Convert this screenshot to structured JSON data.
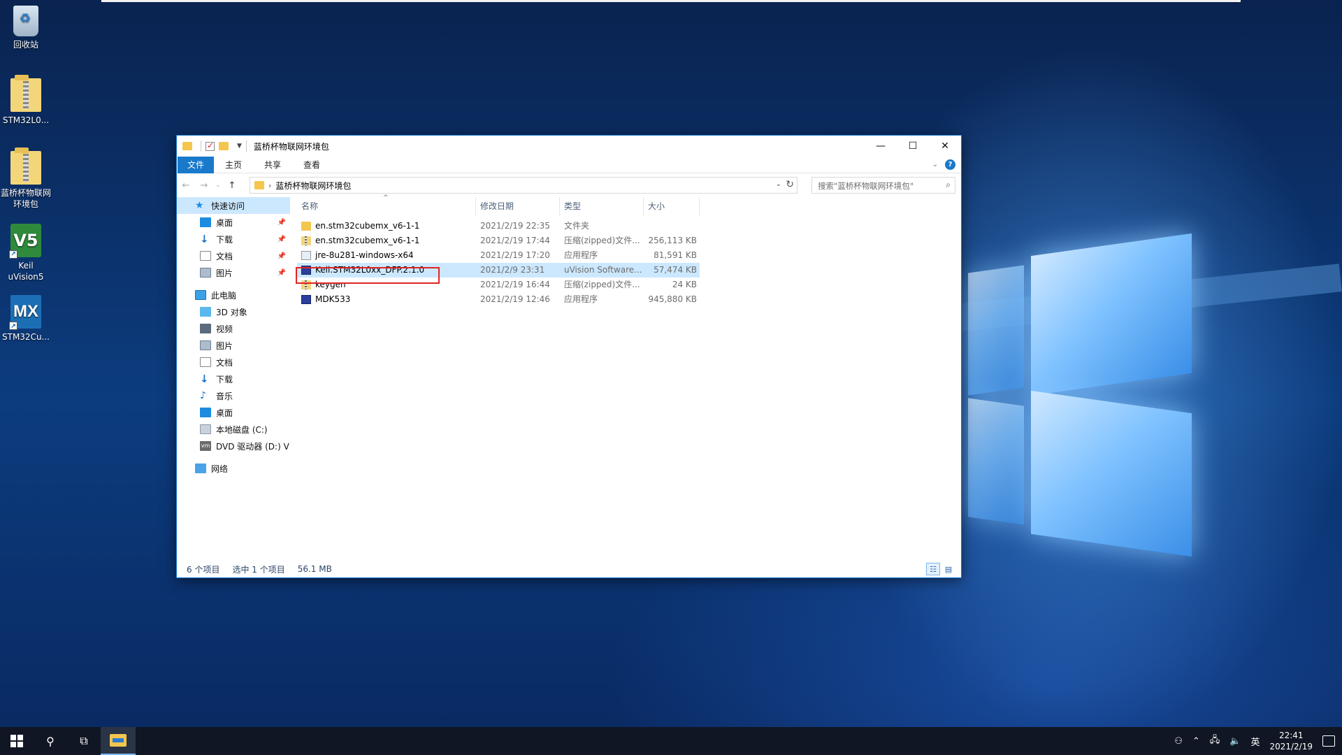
{
  "desktop": {
    "icons": [
      {
        "label": "回收站"
      },
      {
        "label": "STM32L0..."
      },
      {
        "label": "蓝桥杯物联网环境包"
      },
      {
        "label": "Keil uVision5",
        "glyph": "V5"
      },
      {
        "label": "STM32Cu...",
        "glyph": "MX"
      }
    ]
  },
  "window": {
    "title": "蓝桥杯物联网环境包",
    "controls": {
      "minimize": "—",
      "maximize": "☐",
      "close": "✕"
    },
    "ribbon_tabs": [
      "文件",
      "主页",
      "共享",
      "查看"
    ],
    "help": "?",
    "nav_buttons": {
      "back": "←",
      "forward": "→",
      "recent": "⌄",
      "up": "↑"
    },
    "address": {
      "chevron": "›",
      "path": "蓝桥杯物联网环境包",
      "dropdown": "⌄",
      "refresh": "↻"
    },
    "search": {
      "placeholder": "搜索\"蓝桥杯物联网环境包\"",
      "icon": "⌕"
    },
    "nav_pane": {
      "quick_access": "快速访问",
      "quick_items": [
        {
          "label": "桌面",
          "icon": "desktop-icon"
        },
        {
          "label": "下载",
          "icon": "download-icon"
        },
        {
          "label": "文档",
          "icon": "document-icon"
        },
        {
          "label": "图片",
          "icon": "picture-icon"
        }
      ],
      "this_pc": "此电脑",
      "pc_items": [
        {
          "label": "3D 对象",
          "icon": "3d-objects-icon"
        },
        {
          "label": "视频",
          "icon": "video-icon"
        },
        {
          "label": "图片",
          "icon": "picture-icon"
        },
        {
          "label": "文档",
          "icon": "document-icon"
        },
        {
          "label": "下载",
          "icon": "download-icon"
        },
        {
          "label": "音乐",
          "icon": "music-icon"
        },
        {
          "label": "桌面",
          "icon": "desktop-icon"
        },
        {
          "label": "本地磁盘 (C:)",
          "icon": "drive-icon"
        },
        {
          "label": "DVD 驱动器 (D:) V",
          "icon": "dvd-icon",
          "glyph": "vm"
        }
      ],
      "network": "网络"
    },
    "columns": {
      "name": "名称",
      "date": "修改日期",
      "type": "类型",
      "size": "大小"
    },
    "files": [
      {
        "name": "en.stm32cubemx_v6-1-1",
        "date": "2021/2/19 22:35",
        "type": "文件夹",
        "size": "",
        "icon": "folder-icon"
      },
      {
        "name": "en.stm32cubemx_v6-1-1",
        "date": "2021/2/19 17:44",
        "type": "压缩(zipped)文件...",
        "size": "256,113 KB",
        "icon": "zip-icon"
      },
      {
        "name": "jre-8u281-windows-x64",
        "date": "2021/2/19 17:20",
        "type": "应用程序",
        "size": "81,591 KB",
        "icon": "exe-icon"
      },
      {
        "name": "Keil.STM32L0xx_DFP.2.1.0",
        "date": "2021/2/9 23:31",
        "type": "uVision Software...",
        "size": "57,474 KB",
        "icon": "uvision-pack-icon",
        "selected": true
      },
      {
        "name": "keygen",
        "date": "2021/2/19 16:44",
        "type": "压缩(zipped)文件...",
        "size": "24 KB",
        "icon": "zip-icon"
      },
      {
        "name": "MDK533",
        "date": "2021/2/19 12:46",
        "type": "应用程序",
        "size": "945,880 KB",
        "icon": "uvision-setup-icon"
      }
    ],
    "status": {
      "count": "6 个项目",
      "selected": "选中 1 个项目",
      "size": "56.1 MB"
    }
  },
  "taskbar": {
    "clock_time": "22:41",
    "clock_date": "2021/2/19",
    "ime": "英"
  },
  "colors": {
    "accent": "#1979ca",
    "selection": "#cce8ff",
    "highlight_box": "#e02424"
  }
}
